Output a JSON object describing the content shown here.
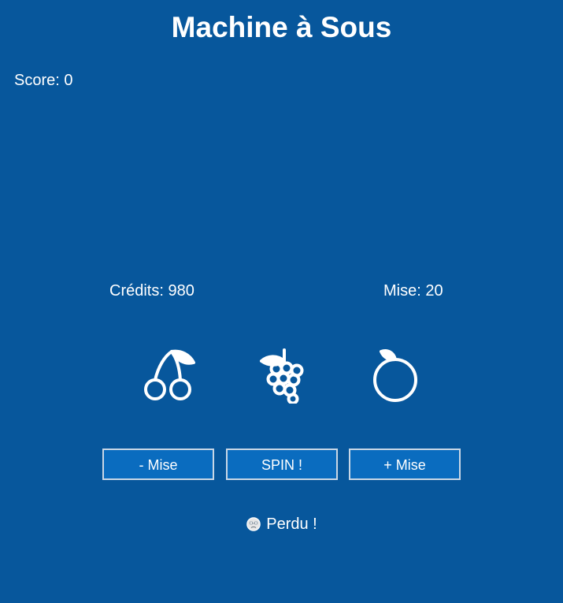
{
  "app": {
    "title": "Machine à Sous"
  },
  "score": {
    "label": "Score: 0"
  },
  "stats": {
    "credits_label": "Crédits: 980",
    "bet_label": "Mise: 20"
  },
  "reels": [
    {
      "icon": "cherry-icon"
    },
    {
      "icon": "grapes-icon"
    },
    {
      "icon": "orange-icon"
    }
  ],
  "controls": {
    "decrease_bet_label": "- Mise",
    "spin_label": "SPIN !",
    "increase_bet_label": "+ Mise"
  },
  "result": {
    "icon": "sad-face-icon",
    "text": "Perdu !"
  },
  "colors": {
    "background": "#07579c",
    "button_fill": "#0a6cbf",
    "button_border": "#c9d7e6",
    "text": "#ffffff"
  }
}
